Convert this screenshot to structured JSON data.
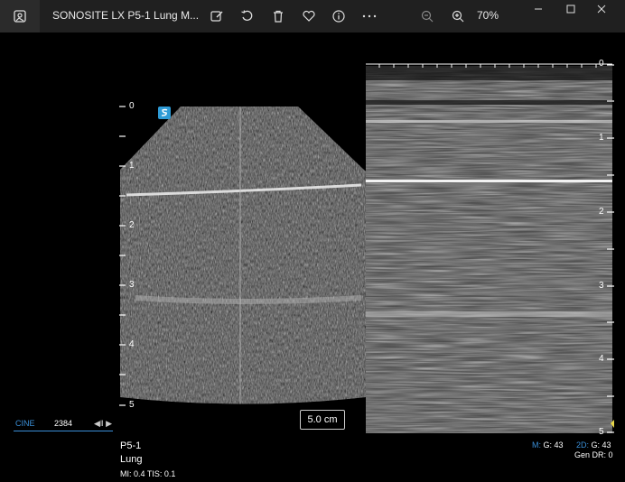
{
  "window": {
    "title": "SONOSITE LX P5-1 Lung M...",
    "zoom": "70%",
    "toolbar_icons": [
      "edit-icon",
      "rotate-icon",
      "delete-icon",
      "favorite-icon",
      "info-icon",
      "more-icon"
    ]
  },
  "ultrasound": {
    "depth_marks_left": [
      "0",
      "1",
      "2",
      "3",
      "4",
      "5"
    ],
    "depth_marks_right": [
      "0",
      "1",
      "2",
      "3",
      "4",
      "5"
    ],
    "cine_label": "CINE",
    "cine_frame": "2384",
    "cine_controls": "◀‖ ▶",
    "scale": "5.0 cm",
    "probe": "P5-1",
    "preset": "Lung",
    "mi_tis": "MI: 0.4  TIS: 0.1",
    "m_gain_label": "M:",
    "m_gain": "G: 43",
    "twod_label": "2D:",
    "twod_gain": "G: 43",
    "gen_dr": "Gen  DR: 0"
  },
  "colors": {
    "accent": "#3a8fd8",
    "titlebar": "#202020"
  }
}
